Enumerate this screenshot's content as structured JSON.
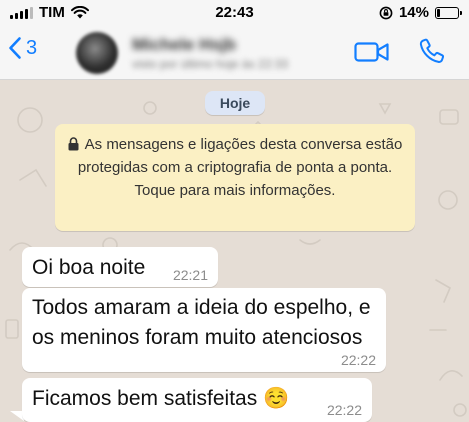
{
  "status_bar": {
    "carrier": "TIM",
    "time": "22:43",
    "battery": "14%",
    "battery_level": 0.14
  },
  "header": {
    "back_count": "3",
    "contact_name": "Michele Hsjb",
    "contact_status": "visto por último hoje às 22:33"
  },
  "chat": {
    "date_chip": "Hoje",
    "encryption_notice": "As mensagens e ligações desta conversa estão protegidas com a criptografia de ponta a ponta. Toque para mais informações.",
    "messages": [
      {
        "text": "Oi boa noite",
        "time": "22:21"
      },
      {
        "text": "Todos amaram a ideia do espelho, e os meninos foram muito atenciosos",
        "time": "22:22"
      },
      {
        "text": "Ficamos bem satisfeitas ☺️",
        "time": "22:22"
      }
    ]
  },
  "colors": {
    "accent": "#127eff",
    "chat_background": "#e5ddd5",
    "notice_background": "#fbf0c4",
    "date_chip_background": "#dde6f6"
  }
}
